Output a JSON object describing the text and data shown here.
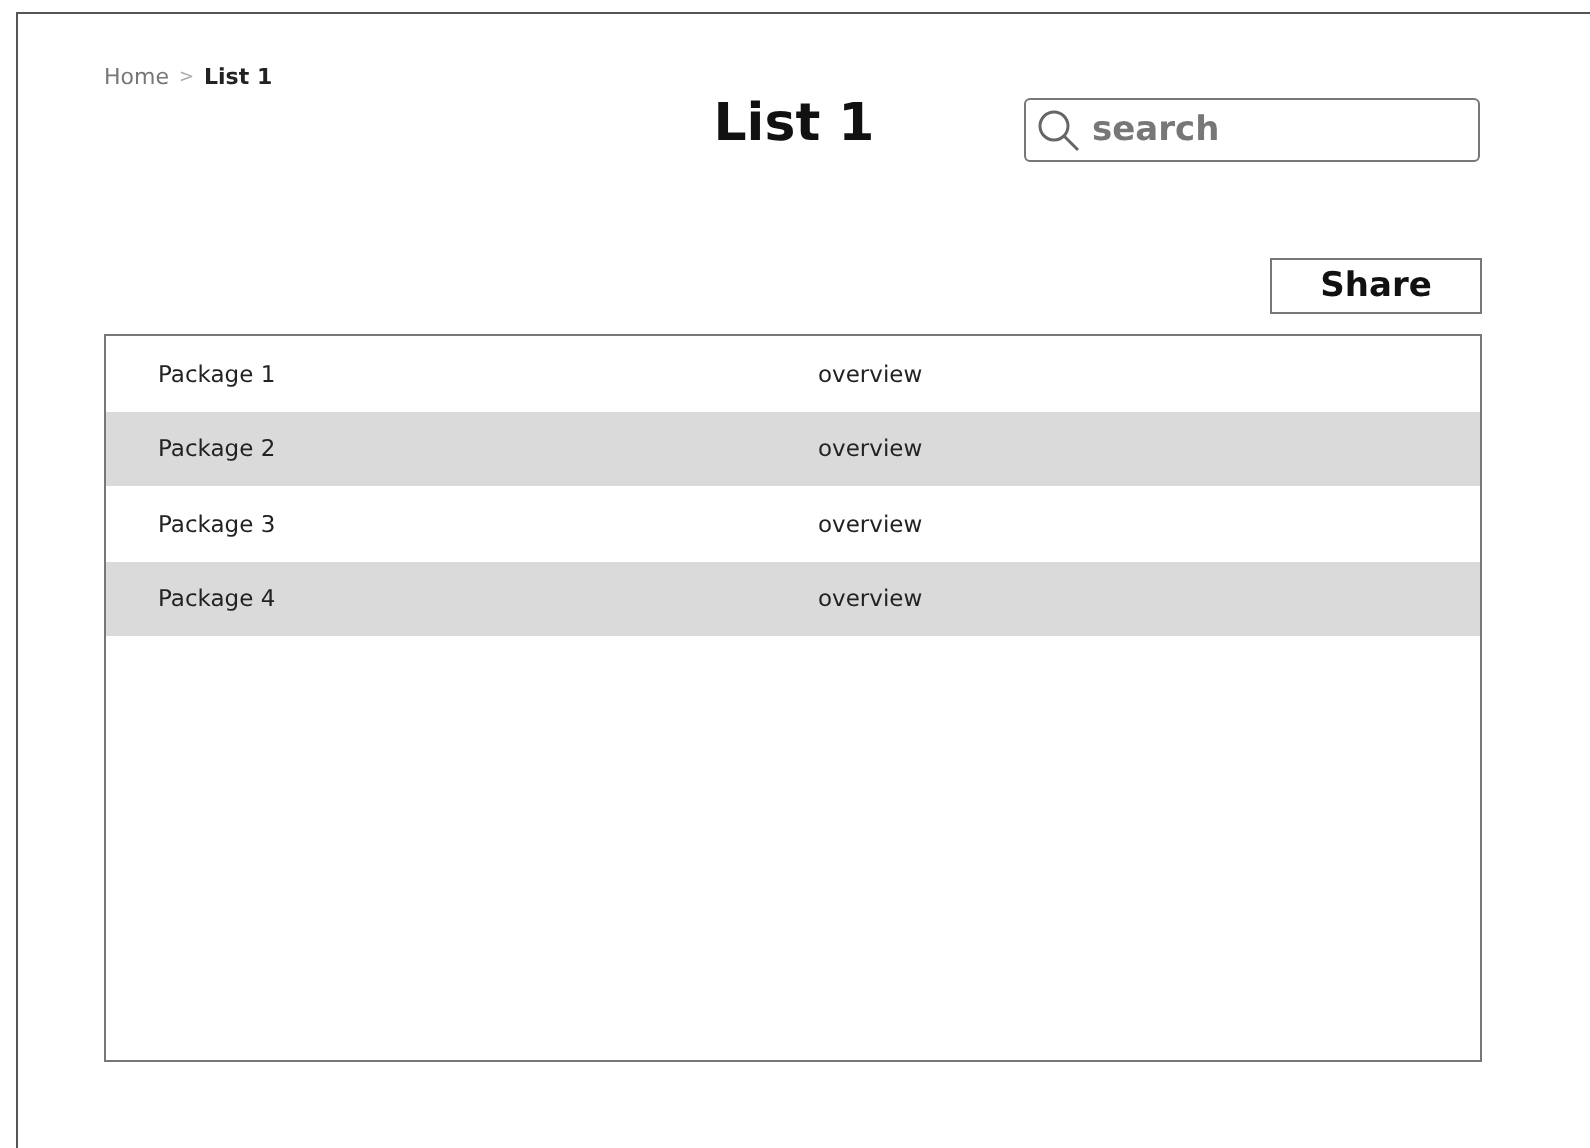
{
  "breadcrumb": {
    "items": [
      {
        "label": "Home",
        "selected": false
      },
      {
        "label": "List 1",
        "selected": true
      }
    ],
    "separator": ">"
  },
  "title": "List 1",
  "search": {
    "placeholder": "search"
  },
  "share_button": "Share",
  "table": {
    "rows": [
      {
        "cells": [
          "Package 1",
          "overview"
        ]
      },
      {
        "cells": [
          "Package 2",
          "overview"
        ]
      },
      {
        "cells": [
          "Package 3",
          "overview"
        ]
      },
      {
        "cells": [
          "Package 4",
          "overview"
        ]
      }
    ]
  }
}
